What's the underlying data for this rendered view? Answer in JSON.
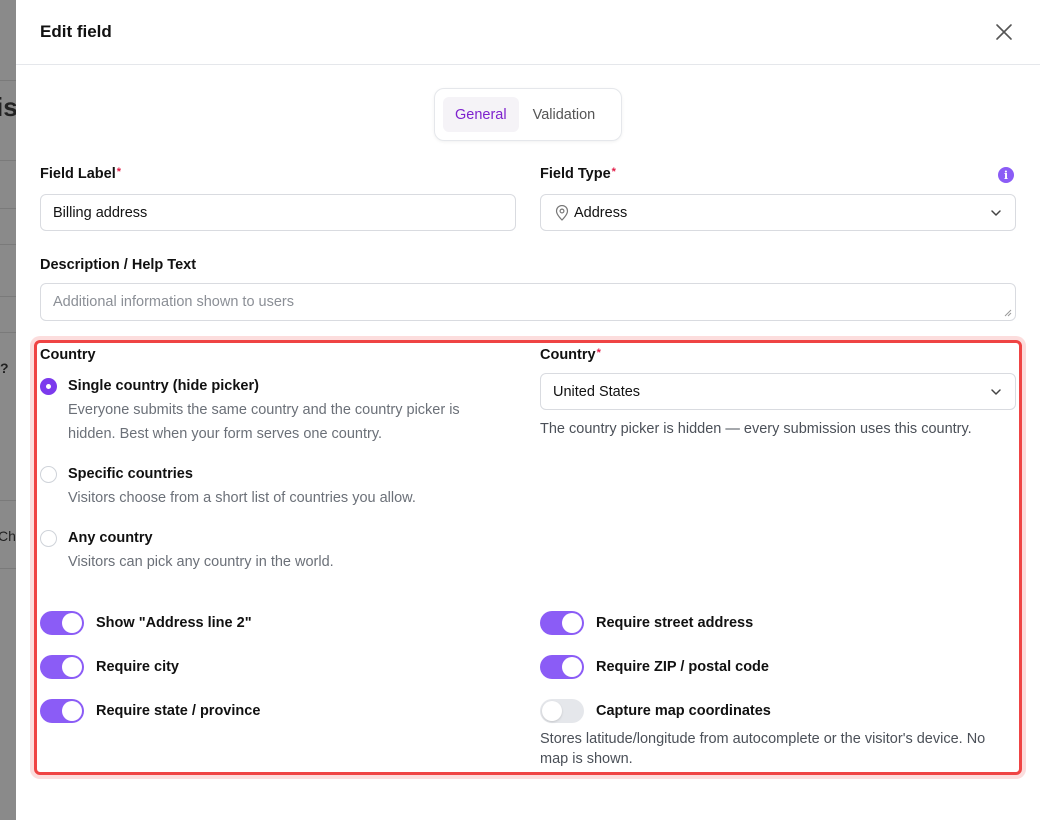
{
  "background": {
    "frag_title": "is",
    "frag_q": "?",
    "frag_ch": "Ch"
  },
  "header": {
    "title": "Edit field"
  },
  "tabs": [
    {
      "label": "General",
      "active": true
    },
    {
      "label": "Validation",
      "active": false
    }
  ],
  "field_label": {
    "label": "Field Label",
    "required_mark": "*",
    "value": "Billing address"
  },
  "field_type": {
    "label": "Field Type",
    "required_mark": "*",
    "value": "Address",
    "icon": "map-pin-icon",
    "info_icon": "info-icon"
  },
  "description": {
    "label": "Description / Help Text",
    "placeholder": "Additional information shown to users"
  },
  "country_mode": {
    "label": "Country",
    "options": [
      {
        "title": "Single country (hide picker)",
        "desc": "Everyone submits the same country and the country picker is hidden. Best when your form serves one country.",
        "checked": true
      },
      {
        "title": "Specific countries",
        "desc": "Visitors choose from a short list of countries you allow.",
        "checked": false
      },
      {
        "title": "Any country",
        "desc": "Visitors can pick any country in the world.",
        "checked": false
      }
    ]
  },
  "country_select": {
    "label": "Country",
    "required_mark": "*",
    "value": "United States",
    "helper": "The country picker is hidden — every submission uses this country."
  },
  "toggles": {
    "address_line2": {
      "label": "Show \"Address line 2\"",
      "on": true
    },
    "require_city": {
      "label": "Require city",
      "on": true
    },
    "require_state": {
      "label": "Require state / province",
      "on": true
    },
    "require_street": {
      "label": "Require street address",
      "on": true
    },
    "require_zip": {
      "label": "Require ZIP / postal code",
      "on": true
    },
    "capture_coords": {
      "label": "Capture map coordinates",
      "on": false,
      "helper": "Stores latitude/longitude from autocomplete or the visitor's device. No map is shown."
    }
  },
  "colors": {
    "accent": "#8b5cf6",
    "accent_text": "#7e22ce",
    "required": "#e11d48",
    "highlight": "#ef4444"
  }
}
